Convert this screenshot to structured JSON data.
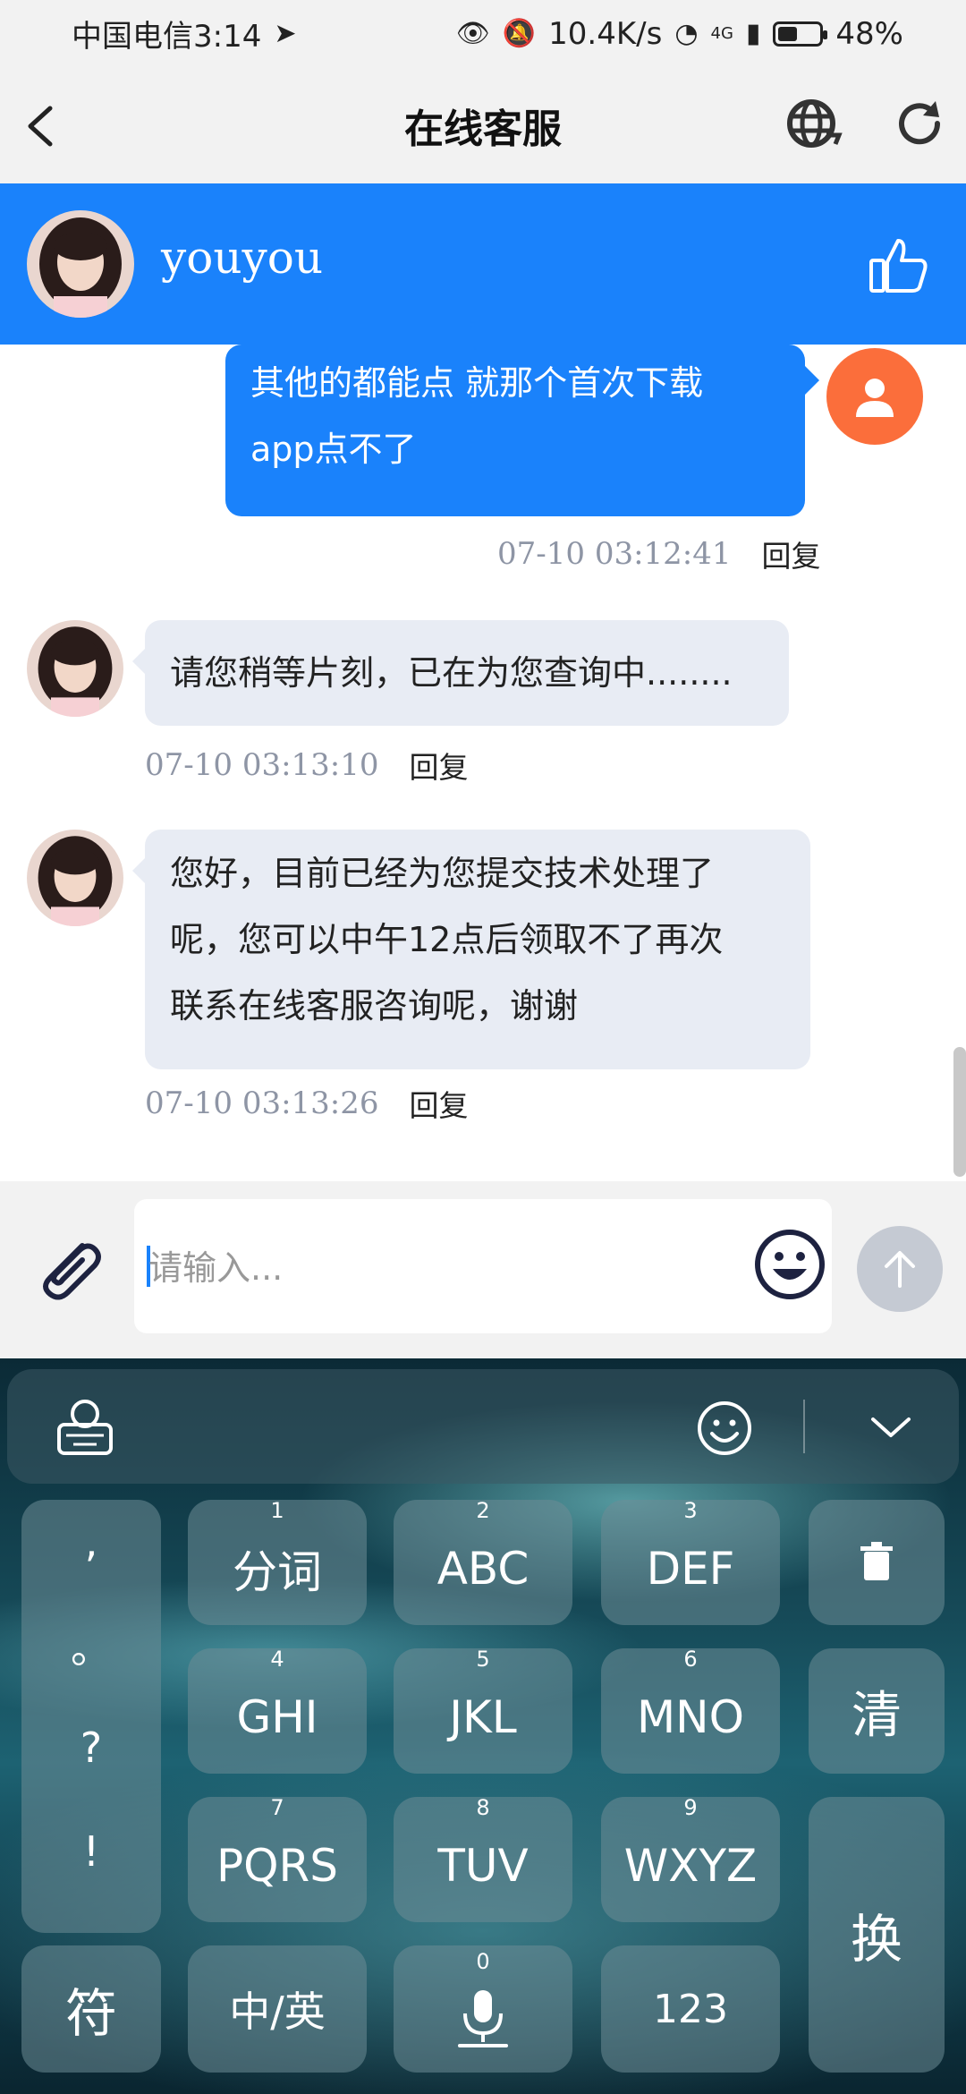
{
  "status_bar": {
    "carrier_time": "中国电信3:14",
    "speed": "10.4K/s",
    "network": "4G",
    "battery": "48%",
    "battery_level": 0.48
  },
  "nav": {
    "title": "在线客服"
  },
  "agent": {
    "name": "youyou"
  },
  "messages": [
    {
      "direction": "out",
      "lines": [
        "其他的都能点 就那个首次下载",
        "app点不了"
      ],
      "time": "07-10 03:12:41",
      "reply": "回复"
    },
    {
      "direction": "in",
      "lines": [
        "请您稍等片刻，已在为您查询中........"
      ],
      "time": "07-10 03:13:10",
      "reply": "回复"
    },
    {
      "direction": "in",
      "lines": [
        "您好，目前已经为您提交技术处理了",
        "呢，您可以中午12点后领取不了再次",
        "联系在线客服咨询呢，谢谢"
      ],
      "time": "07-10 03:13:26",
      "reply": "回复"
    }
  ],
  "input": {
    "placeholder": "请输入..."
  },
  "keyboard": {
    "punctuation": [
      ",",
      "。",
      "?",
      "!"
    ],
    "rows": [
      [
        {
          "num": "1",
          "label": "分词"
        },
        {
          "num": "2",
          "label": "ABC"
        },
        {
          "num": "3",
          "label": "DEF"
        }
      ],
      [
        {
          "num": "4",
          "label": "GHI"
        },
        {
          "num": "5",
          "label": "JKL"
        },
        {
          "num": "6",
          "label": "MNO"
        }
      ],
      [
        {
          "num": "7",
          "label": "PQRS"
        },
        {
          "num": "8",
          "label": "TUV"
        },
        {
          "num": "9",
          "label": "WXYZ"
        }
      ]
    ],
    "clear": "清",
    "switch": "换",
    "symbols": "符",
    "lang": "中/英",
    "space_num": "0",
    "numbers": "123"
  }
}
